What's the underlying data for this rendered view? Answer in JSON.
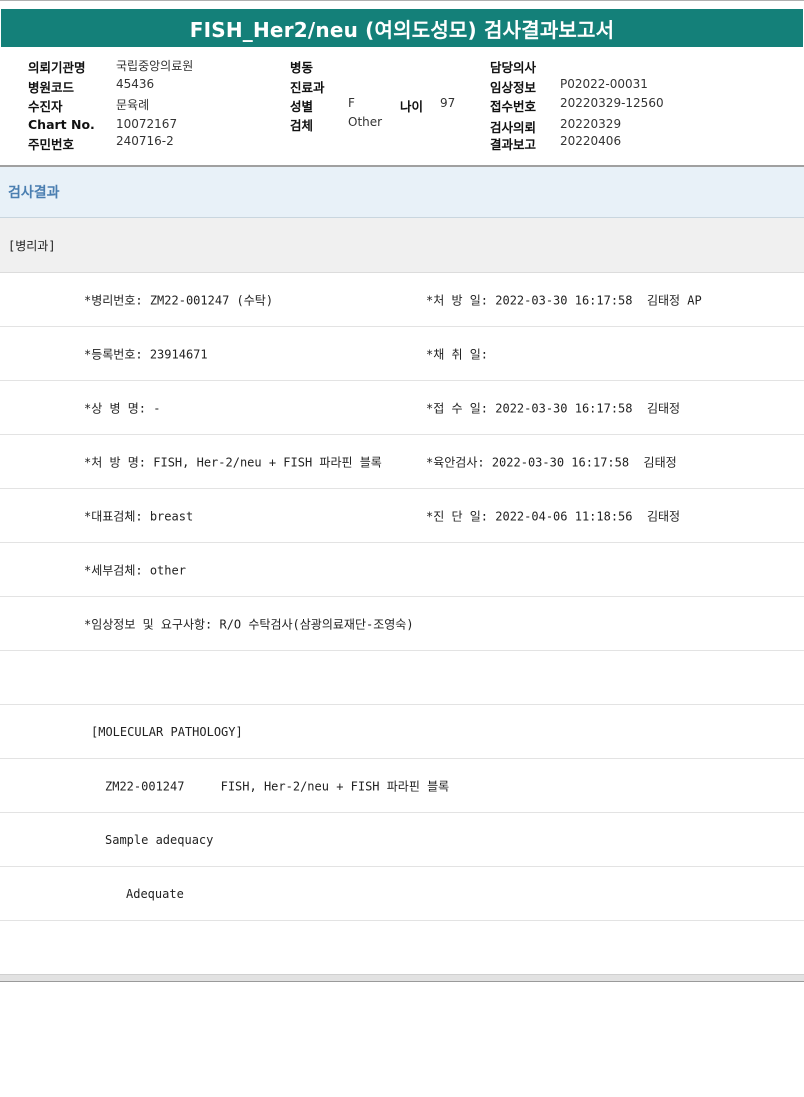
{
  "title": "FISH_Her2/neu (여의도성모) 검사결과보고서",
  "info": {
    "institution_label": "의뢰기관명",
    "institution_value": "국립중앙의료원",
    "hospital_code_label": "병원코드",
    "hospital_code_value": "45436",
    "recipient_label": "수진자",
    "recipient_value": "문육례",
    "chart_label": "Chart No.",
    "chart_value": "10072167",
    "resident_label": "주민번호",
    "resident_value": "240716-2",
    "ward_label": "병동",
    "ward_value": "",
    "dept_label": "진료과",
    "dept_value": "",
    "sex_label": "성별",
    "sex_value": "F",
    "age_label": "나이",
    "age_value": "97",
    "specimen_label": "검체",
    "specimen_value": "Other",
    "doctor_label": "담당의사",
    "doctor_value": "",
    "clinical_label": "임상정보",
    "clinical_value": "P02022-00031",
    "receipt_label": "접수번호",
    "receipt_value": "20220329-12560",
    "request_label": "검사의뢰",
    "request_value": "20220329",
    "report_label": "결과보고",
    "report_value": "20220406"
  },
  "section_title": "검사결과",
  "department": "[병리과]",
  "rows": [
    {
      "left": "*병리번호: ZM22-001247 (수탁)",
      "right": "*처 방 일: 2022-03-30 16:17:58  김태정 AP"
    },
    {
      "left": "*등록번호: 23914671",
      "right": "*채 취 일:"
    },
    {
      "left": "*상 병 명: -",
      "right": "*접 수 일: 2022-03-30 16:17:58  김태정"
    },
    {
      "left": "*처 방 명: FISH, Her-2/neu + FISH 파라핀 블록",
      "right": "*육안검사: 2022-03-30 16:17:58  김태정"
    },
    {
      "left": "*대표검체: breast",
      "right": "*진 단 일: 2022-04-06 11:18:56  김태정"
    },
    {
      "left": "*세부검체: other",
      "right": ""
    },
    {
      "left": "*임상정보 및 요구사항: R/O 수탁검사(삼광의료재단-조영숙)",
      "right": ""
    }
  ],
  "report": {
    "header": "[MOLECULAR PATHOLOGY]",
    "case_line": "ZM22-001247     FISH, Her-2/neu + FISH 파라핀 블록",
    "adequacy_label": "Sample adequacy",
    "adequacy_value": "Adequate"
  }
}
